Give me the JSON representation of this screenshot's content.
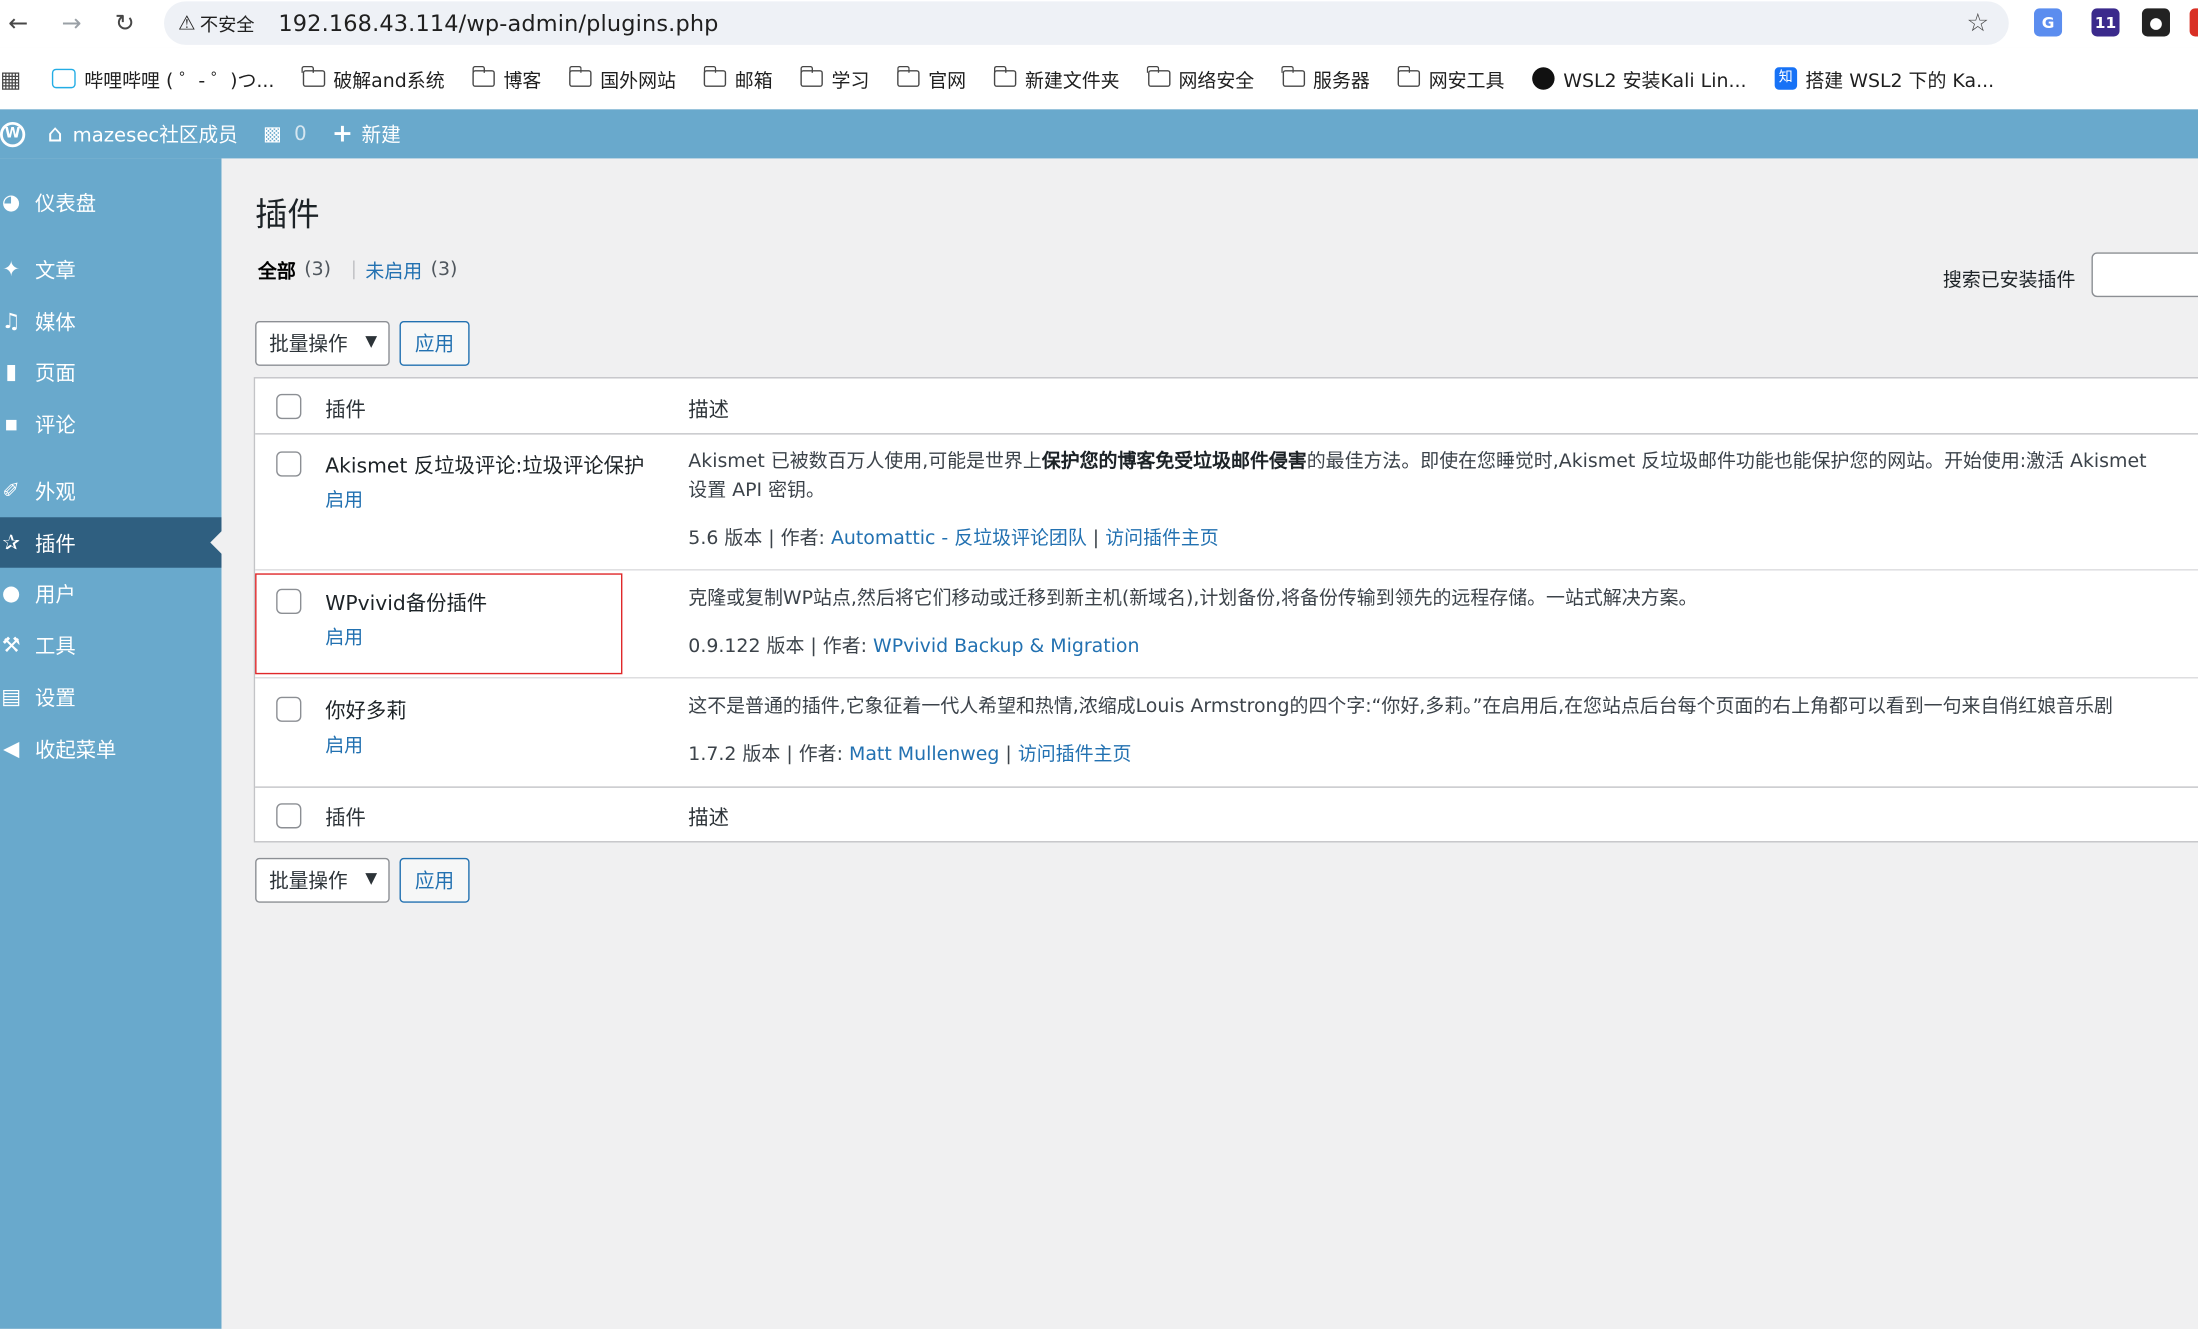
{
  "browser": {
    "insecure_label": "不安全",
    "url": "192.168.43.114/wp-admin/plugins.php",
    "ext_badge": "11"
  },
  "bookmarks": [
    {
      "label": "哔哩哔哩 ( ゜- ゜)つ...",
      "icon": "bilibili-icon"
    },
    {
      "label": "破解and系统",
      "icon": "folder-icon"
    },
    {
      "label": "博客",
      "icon": "folder-icon"
    },
    {
      "label": "国外网站",
      "icon": "folder-icon"
    },
    {
      "label": "邮箱",
      "icon": "folder-icon"
    },
    {
      "label": "学习",
      "icon": "folder-icon"
    },
    {
      "label": "官网",
      "icon": "folder-icon"
    },
    {
      "label": "新建文件夹",
      "icon": "folder-icon"
    },
    {
      "label": "网络安全",
      "icon": "folder-icon"
    },
    {
      "label": "服务器",
      "icon": "folder-icon"
    },
    {
      "label": "网安工具",
      "icon": "folder-icon"
    },
    {
      "label": "WSL2 安装Kali Lin...",
      "icon": "github-icon"
    },
    {
      "label": "搭建 WSL2 下的 Ka...",
      "icon": "zhihu-icon"
    }
  ],
  "adminbar": {
    "site_name": "mazesec社区成员",
    "comments_count": "0",
    "new_label": "新建"
  },
  "sidebar": {
    "items": [
      {
        "label": "仪表盘",
        "icon": "dashboard-icon"
      },
      {
        "label": "文章",
        "icon": "pin-icon"
      },
      {
        "label": "媒体",
        "icon": "media-icon"
      },
      {
        "label": "页面",
        "icon": "page-icon"
      },
      {
        "label": "评论",
        "icon": "comment-icon"
      },
      {
        "label": "外观",
        "icon": "brush-icon"
      },
      {
        "label": "插件",
        "icon": "plugin-icon"
      },
      {
        "label": "用户",
        "icon": "user-icon"
      },
      {
        "label": "工具",
        "icon": "wrench-icon"
      },
      {
        "label": "设置",
        "icon": "settings-icon"
      },
      {
        "label": "收起菜单",
        "icon": "collapse-icon"
      }
    ]
  },
  "page": {
    "title": "插件",
    "filter_all": "全部",
    "filter_all_count": "(3)",
    "filter_sep": "|",
    "filter_inactive": "未启用",
    "filter_inactive_count": "(3)",
    "search_label": "搜索已安装插件",
    "bulk_label": "批量操作",
    "apply_label": "应用"
  },
  "table": {
    "col_plugin": "插件",
    "col_desc": "描述",
    "activate_label": "启用",
    "version_suffix": "版本 | 作者:",
    "rows": [
      {
        "name": "Akismet 反垃圾评论:垃圾评论保护",
        "desc_pre": "Akismet 已被数百万人使用,可能是世界上",
        "desc_bold": "保护您的博客免受垃圾邮件侵害",
        "desc_post": "的最佳方法。即使在您睡觉时,Akismet 反垃圾邮件功能也能保护您的网站。开始使用:激活 Akismet",
        "desc_line2": "设置 API 密钥。",
        "version": "5.6",
        "author": "Automattic - 反垃圾评论团队",
        "sep": "|",
        "homepage": "访问插件主页"
      },
      {
        "name": "WPvivid备份插件",
        "desc": "克隆或复制WP站点,然后将它们移动或迁移到新主机(新域名),计划备份,将备份传输到领先的远程存储。一站式解决方案。",
        "version": "0.9.122",
        "author": "WPvivid Backup & Migration"
      },
      {
        "name": "你好多莉",
        "desc": "这不是普通的插件,它象征着一代人希望和热情,浓缩成Louis Armstrong的四个字:“你好,多莉。”在启用后,在您站点后台每个页面的右上角都可以看到一句来自俏红娘音乐剧",
        "version": "1.7.2",
        "author": "Matt Mullenweg",
        "sep": "|",
        "homepage": "访问插件主页"
      }
    ]
  },
  "colors": {
    "admin_bar": "#69a9cc",
    "sidebar": "#69a9cc",
    "sidebar_current": "#2f5f80",
    "link": "#2271b1",
    "highlight_border": "#e0282a"
  }
}
